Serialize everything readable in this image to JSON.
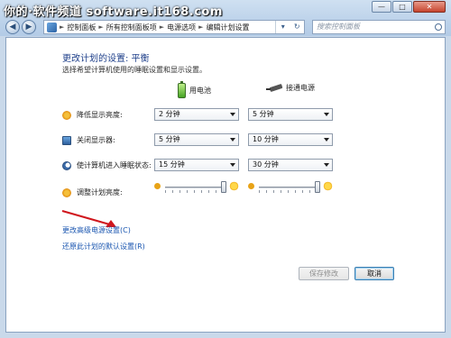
{
  "watermark": "你的·软件频道 software.it168.com",
  "window_controls": {
    "minimize": "—",
    "maximize": "□",
    "close": "✕"
  },
  "nav": {
    "back": "◀",
    "forward": "▶",
    "breadcrumbs": [
      "控制面板",
      "所有控制面板项",
      "电源选项",
      "编辑计划设置"
    ],
    "separator": "►",
    "dropdown": "▾",
    "refresh": "↻",
    "search_placeholder": "搜索控制面板"
  },
  "page": {
    "title": "更改计划的设置: 平衡",
    "subtitle": "选择希望计算机使用的睡眠设置和显示设置。"
  },
  "columns": {
    "battery": "用电池",
    "plugged_in": "接通电源"
  },
  "settings": [
    {
      "label": "降低显示亮度:",
      "icon": "brightness-icon",
      "battery": "2 分钟",
      "plugged_in": "5 分钟"
    },
    {
      "label": "关闭显示器:",
      "icon": "monitor-icon",
      "battery": "5 分钟",
      "plugged_in": "10 分钟"
    },
    {
      "label": "使计算机进入睡眠状态:",
      "icon": "sleep-icon",
      "battery": "15 分钟",
      "plugged_in": "30 分钟"
    }
  ],
  "brightness": {
    "label": "调整计划亮度:",
    "battery_level": 1.0,
    "plugged_in_level": 1.0
  },
  "links": {
    "advanced": "更改高级电源设置(C)",
    "restore": "还原此计划的默认设置(R)"
  },
  "buttons": {
    "save": "保存修改",
    "cancel": "取消"
  },
  "colors": {
    "title": "#1e3f8a",
    "link": "#1a56b0",
    "annotation_arrow": "#d0161d"
  }
}
